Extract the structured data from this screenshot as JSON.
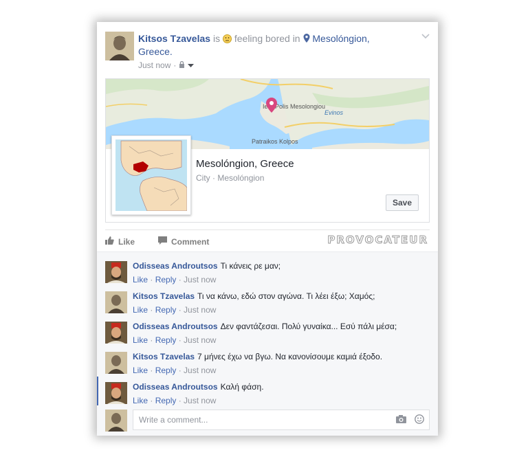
{
  "post": {
    "author": "Kitsos Tzavelas",
    "is_word": "is",
    "feeling_text": "feeling bored in",
    "location_line1": "Mesolóngion,",
    "location_line2": "Greece.",
    "timestamp": "Just now",
    "icons": [
      "smiley-icon",
      "pin-icon",
      "lock-icon",
      "caret-down-icon",
      "chevron-down-icon"
    ]
  },
  "map": {
    "labels": [
      "Iera Polis Mesolongiou",
      "Evinos",
      "Patraikos Kolpos"
    ]
  },
  "place": {
    "title": "Mesolóngion, Greece",
    "subtitle": "City · Mesolóngion",
    "save_label": "Save"
  },
  "actions": {
    "like": "Like",
    "comment": "Comment",
    "watermark": "PROVOCATEUR"
  },
  "comments": [
    {
      "author": "Odisseas Androutsos",
      "text": "Τι κάνεις ρε μαν;",
      "like": "Like",
      "reply": "Reply",
      "time": "Just now"
    },
    {
      "author": "Kitsos Tzavelas",
      "text": "Τι να κάνω, εδώ στον αγώνα. Τι λέει έξω; Χαμός;",
      "like": "Like",
      "reply": "Reply",
      "time": "Just now"
    },
    {
      "author": "Odisseas Androutsos",
      "text": "Δεν φαντάζεσαι. Πολύ γυναίκα... Εσύ πάλι μέσα;",
      "like": "Like",
      "reply": "Reply",
      "time": "Just now"
    },
    {
      "author": "Kitsos Tzavelas",
      "text": "7 μήνες έχω να βγω. Να κανονίσουμε καμιά έξοδο.",
      "like": "Like",
      "reply": "Reply",
      "time": "Just now"
    },
    {
      "author": "Odisseas Androutsos",
      "text": "Καλή φάση.",
      "like": "Like",
      "reply": "Reply",
      "time": "Just now"
    }
  ],
  "composer": {
    "placeholder": "Write a comment..."
  },
  "colors": {
    "link": "#365899",
    "meta": "#90949c",
    "map_water": "#aadaff",
    "map_land": "#f2efe9",
    "pin": "#d9467f",
    "region": "#b30000"
  }
}
